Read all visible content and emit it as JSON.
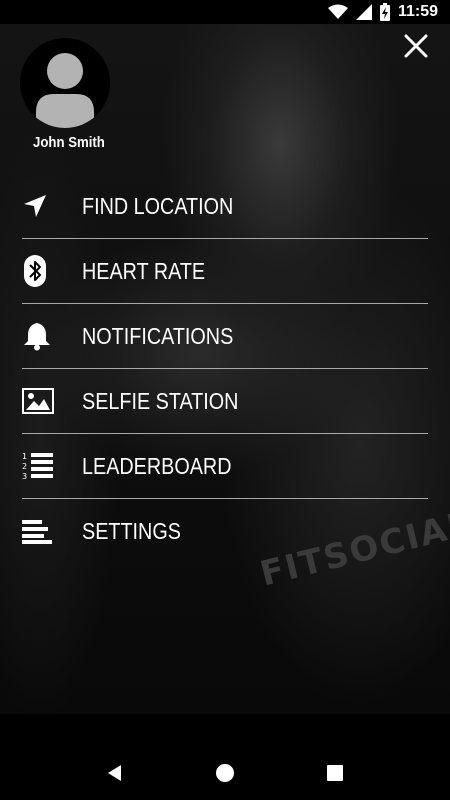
{
  "status_bar": {
    "time": "11:59",
    "icons": [
      "wifi-icon",
      "signal-icon",
      "battery-charging-icon"
    ]
  },
  "user": {
    "name": "John Smith"
  },
  "background": {
    "watermark": "FITSOCIAL"
  },
  "menu": {
    "items": [
      {
        "label": "FIND LOCATION",
        "icon": "location-arrow-icon"
      },
      {
        "label": "HEART RATE",
        "icon": "bluetooth-icon"
      },
      {
        "label": "NOTIFICATIONS",
        "icon": "bell-icon"
      },
      {
        "label": "SELFIE STATION",
        "icon": "image-icon"
      },
      {
        "label": "LEADERBOARD",
        "icon": "ordered-list-icon"
      },
      {
        "label": "SETTINGS",
        "icon": "settings-lines-icon"
      }
    ]
  },
  "nav_bar": {
    "buttons": [
      "back-icon",
      "home-icon",
      "recents-icon"
    ]
  }
}
